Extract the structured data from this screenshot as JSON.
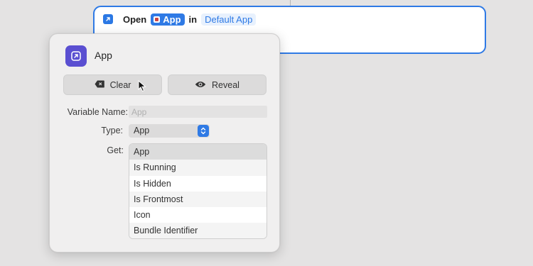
{
  "action": {
    "verb": "Open",
    "app_token": "App",
    "preposition": "in",
    "parameter": "Default App",
    "icon": "arrow-up-right-icon"
  },
  "popover": {
    "icon": "arrow-up-right-icon",
    "title": "App",
    "clear_button": {
      "label": "Clear",
      "icon": "delete-left-icon"
    },
    "reveal_button": {
      "label": "Reveal",
      "icon": "eye-icon"
    },
    "variable_name": {
      "label": "Variable Name:",
      "placeholder": "App",
      "value": ""
    },
    "type": {
      "label": "Type:",
      "value": "App"
    },
    "get": {
      "label": "Get:",
      "options": [
        "App",
        "Is Running",
        "Is Hidden",
        "Is Frontmost",
        "Icon",
        "Bundle Identifier"
      ],
      "selected": "App"
    }
  },
  "colors": {
    "accent": "#2f7ae5",
    "popover_icon": "#5a4fd1",
    "background": "#e4e3e3"
  }
}
